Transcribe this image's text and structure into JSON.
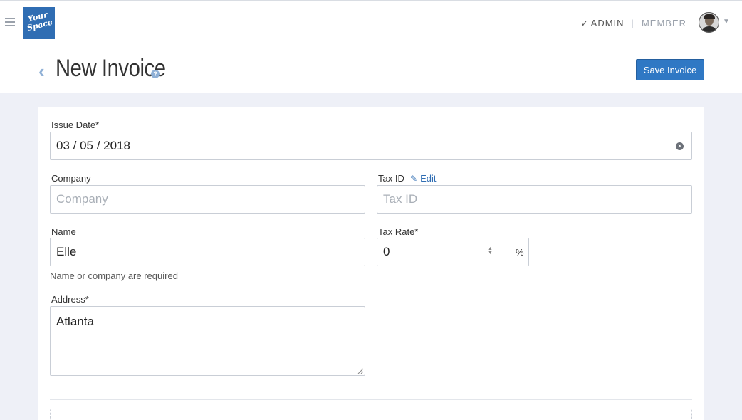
{
  "header": {
    "logo_text": "Your Space",
    "roles": {
      "admin": "ADMIN",
      "member": "MEMBER",
      "active": "admin"
    },
    "title": "New Invoice",
    "save_label": "Save Invoice"
  },
  "form": {
    "issue_date": {
      "label": "Issue Date*",
      "value": "03 / 05 / 2018"
    },
    "company": {
      "label": "Company",
      "placeholder": "Company",
      "value": ""
    },
    "tax_id": {
      "label": "Tax ID",
      "edit_label": "Edit",
      "placeholder": "Tax ID",
      "value": ""
    },
    "name": {
      "label": "Name",
      "value": "Elle",
      "hint": "Name or company are required"
    },
    "tax_rate": {
      "label": "Tax Rate*",
      "value": "0",
      "unit": "%"
    },
    "address": {
      "label": "Address*",
      "value": "Atlanta"
    }
  },
  "colors": {
    "accent": "#2f78c4",
    "brand": "#2f6db3",
    "background": "#eef0f7"
  },
  "icons": [
    "hamburger-icon",
    "check-icon",
    "chevron-left-icon",
    "help-icon",
    "clear-icon",
    "pencil-icon",
    "chevron-down-icon"
  ]
}
